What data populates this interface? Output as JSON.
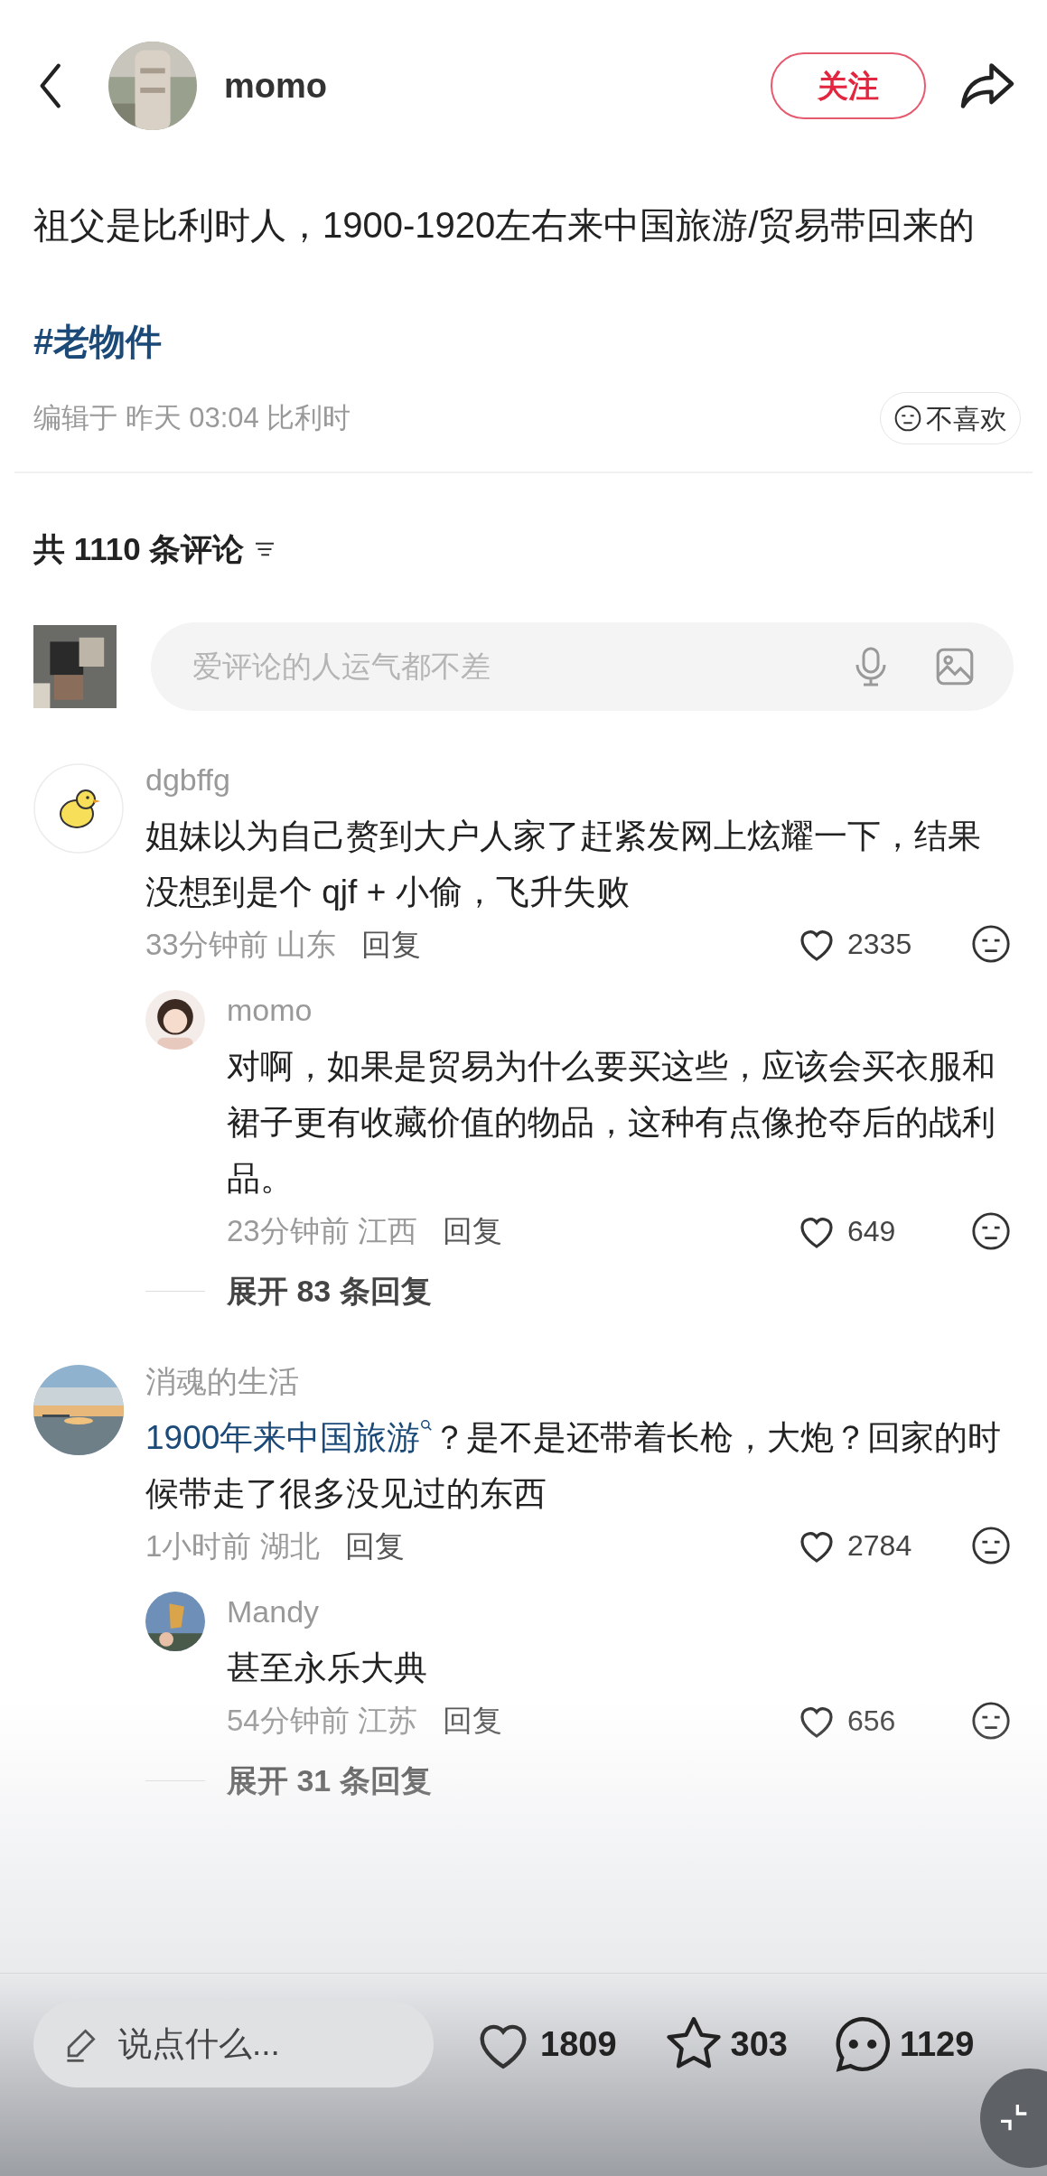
{
  "header": {
    "username": "momo",
    "follow_button": "关注"
  },
  "post": {
    "text": "祖父是比利时人，1900-1920左右来中国旅游/贸易带回来的",
    "hashtag": "#老物件",
    "meta": "编辑于 昨天 03:04 比利时",
    "dislike_button": "不喜欢"
  },
  "comments_header": {
    "title": "共 1110 条评论"
  },
  "comment_input": {
    "placeholder": "爱评论的人运气都不差"
  },
  "comments": [
    {
      "avatar": {
        "kind": "emoji"
      },
      "username": "dgbffg",
      "text": "姐妹以为自己赘到大户人家了赶紧发网上炫耀一下，结果没想到是个 qjf + 小偷，飞升失败",
      "time": "33分钟前",
      "location": "山东",
      "reply_button": "回复",
      "likes": "2335",
      "replies": [
        {
          "avatar": {
            "kind": "picture"
          },
          "username": "momo",
          "text": "对啊，如果是贸易为什么要买这些，应该会买衣服和裙子更有收藏价值的物品，这种有点像抢夺后的战利品。",
          "time": "23分钟前",
          "location": "江西",
          "reply_button": "回复",
          "likes": "649"
        }
      ],
      "expand": "展开 83 条回复"
    },
    {
      "avatar": {
        "kind": "picture"
      },
      "username": "消魂的生活",
      "link": "1900年来中国旅游",
      "text": "？是不是还带着长枪，大炮？回家的时候带走了很多没见过的东西",
      "time": "1小时前",
      "location": "湖北",
      "reply_button": "回复",
      "likes": "2784",
      "replies": [
        {
          "avatar": {
            "kind": "picture"
          },
          "username": "Mandy",
          "text": "甚至永乐大典",
          "time": "54分钟前",
          "location": "江苏",
          "reply_button": "回复",
          "likes": "656"
        }
      ],
      "expand": "展开 31 条回复"
    }
  ],
  "bottom_bar": {
    "input_placeholder": "说点什么...",
    "likes": "1809",
    "favorites": "303",
    "comments": "1129"
  }
}
